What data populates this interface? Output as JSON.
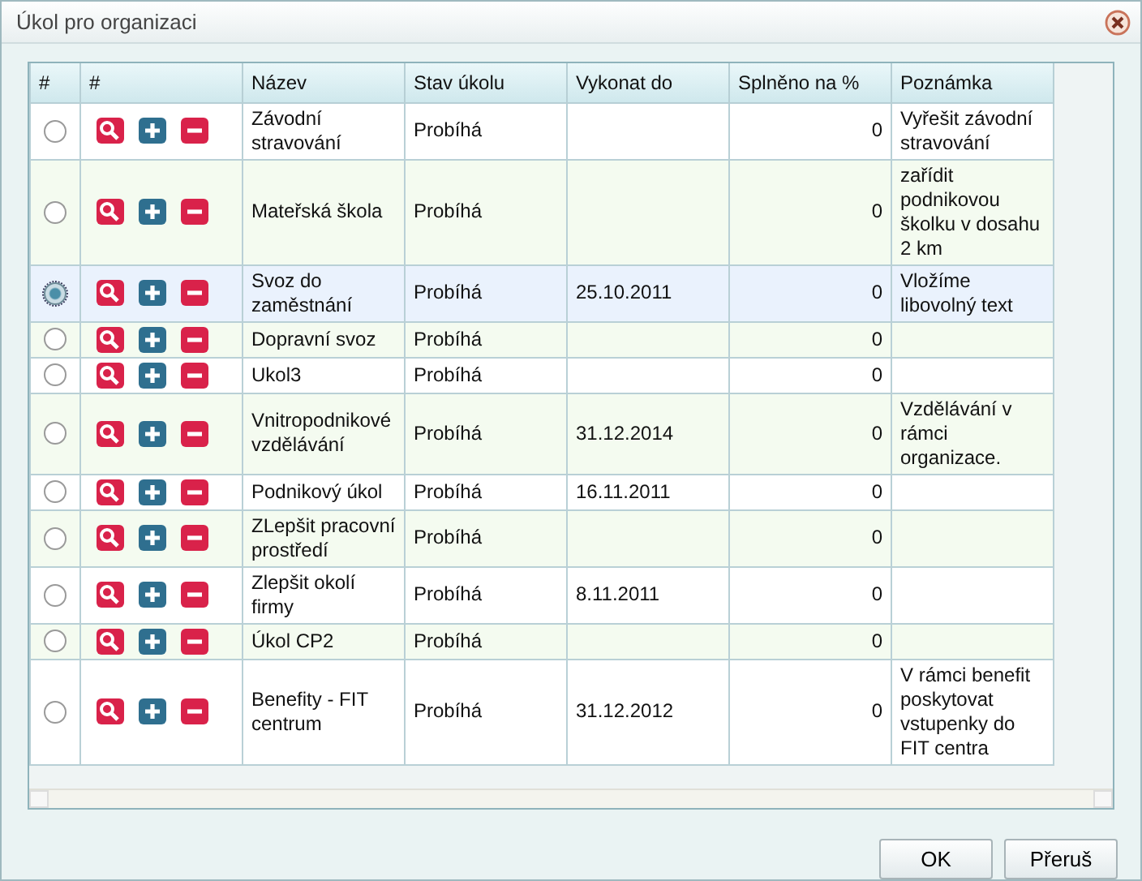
{
  "window": {
    "title": "Úkol pro organizaci"
  },
  "table": {
    "columns": [
      "#",
      "#",
      "Název",
      "Stav úkolu",
      "Vykonat do",
      "Splněno na %",
      "Poznámka"
    ],
    "rows": [
      {
        "selected": false,
        "name": "Závodní stravování",
        "status": "Probíhá",
        "due": "",
        "done": "0",
        "note": "Vyřešit závodní stravování"
      },
      {
        "selected": false,
        "name": "Mateřská škola",
        "status": "Probíhá",
        "due": "",
        "done": "0",
        "note": "zařídit podnikovou školku v dosahu 2 km"
      },
      {
        "selected": true,
        "name": "Svoz do zaměstnání",
        "status": "Probíhá",
        "due": "25.10.2011",
        "done": "0",
        "note": "Vložíme libovolný text"
      },
      {
        "selected": false,
        "name": "Dopravní svoz",
        "status": "Probíhá",
        "due": "",
        "done": "0",
        "note": ""
      },
      {
        "selected": false,
        "name": "Ukol3",
        "status": "Probíhá",
        "due": "",
        "done": "0",
        "note": ""
      },
      {
        "selected": false,
        "name": "Vnitropodnikové vzdělávání",
        "status": "Probíhá",
        "due": "31.12.2014",
        "done": "0",
        "note": "Vzdělávání v rámci organizace."
      },
      {
        "selected": false,
        "name": "Podnikový úkol",
        "status": "Probíhá",
        "due": "16.11.2011",
        "done": "0",
        "note": ""
      },
      {
        "selected": false,
        "name": "ZLepšit pracovní prostředí",
        "status": "Probíhá",
        "due": "",
        "done": "0",
        "note": ""
      },
      {
        "selected": false,
        "name": "Zlepšit okolí firmy",
        "status": "Probíhá",
        "due": "8.11.2011",
        "done": "0",
        "note": ""
      },
      {
        "selected": false,
        "name": "Úkol CP2",
        "status": "Probíhá",
        "due": "",
        "done": "0",
        "note": ""
      },
      {
        "selected": false,
        "name": "Benefity - FIT centrum",
        "status": "Probíhá",
        "due": "31.12.2012",
        "done": "0",
        "note": "V rámci benefit poskytovat vstupenky do FIT centra"
      }
    ]
  },
  "buttons": [
    "OK",
    "Přeruš"
  ]
}
